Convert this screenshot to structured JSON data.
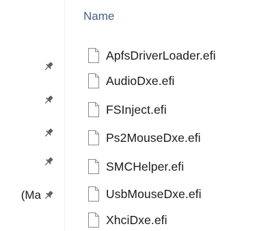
{
  "header": {
    "column_name": "Name"
  },
  "quick_access": {
    "truncated_label": "(Ma",
    "pin_icon": "pin-icon"
  },
  "files": [
    {
      "name": "ApfsDriverLoader.efi",
      "icon": "file-icon"
    },
    {
      "name": "AudioDxe.efi",
      "icon": "file-icon"
    },
    {
      "name": "FSInject.efi",
      "icon": "file-icon"
    },
    {
      "name": "Ps2MouseDxe.efi",
      "icon": "file-icon"
    },
    {
      "name": "SMCHelper.efi",
      "icon": "file-icon"
    },
    {
      "name": "UsbMouseDxe.efi",
      "icon": "file-icon"
    },
    {
      "name": "XhciDxe.efi",
      "icon": "file-icon"
    }
  ],
  "colors": {
    "header_text": "#4c607a",
    "text": "#1a1a1a",
    "pin": "#5f5f5f",
    "file_outline": "#8a8a8a"
  }
}
